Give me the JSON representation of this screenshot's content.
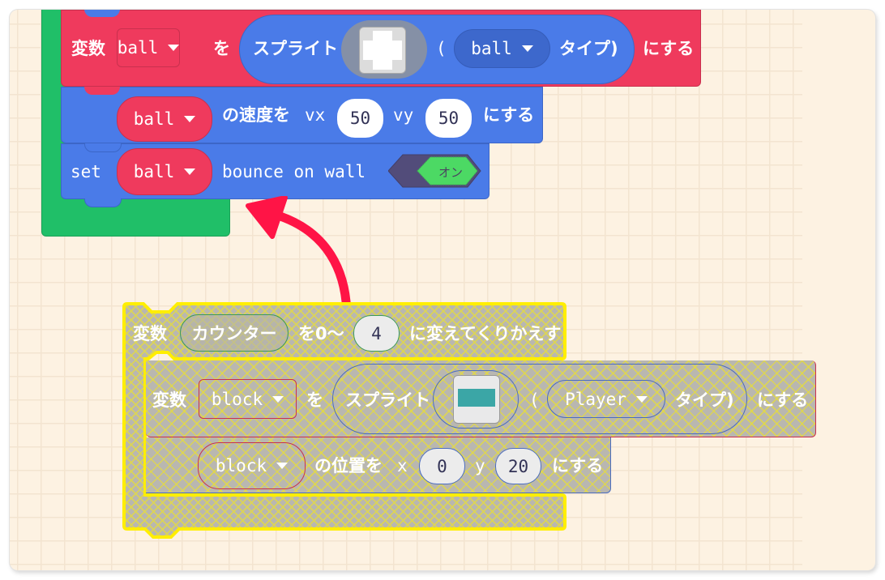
{
  "colors": {
    "workspace_bg": "#fdf2e2",
    "loop_green": "#20bf68",
    "variables_red": "#ef3a5d",
    "sprites_blue": "#4a7be8",
    "disabled_gray": "#b9b7b0",
    "highlight_yellow": "#ffee00",
    "arrow_red": "#ff1446",
    "toggle_on_green": "#4cd964",
    "toggle_track": "#524c7a"
  },
  "top_stack": {
    "set_var_block": {
      "prefix": "変数",
      "variable": "ball",
      "to_label": "を",
      "sprite_label": "スプライト",
      "sprite_image_icon": "white-plus-sprite-icon",
      "open_paren": "(",
      "kind": "ball",
      "kind_suffix": "タイプ)",
      "suffix": "にする"
    },
    "velocity_block": {
      "sprite": "ball",
      "label": "の速度を",
      "vx_label": "vx",
      "vx": "50",
      "vy_label": "vy",
      "vy": "50",
      "suffix": "にする"
    },
    "bounce_block": {
      "prefix": "set",
      "sprite": "ball",
      "label": "bounce on wall",
      "toggle_label": "オン",
      "toggle_state": "on"
    }
  },
  "arrow": {
    "icon": "curved-arrow-up-left-icon"
  },
  "dragged_stack": {
    "loop_block": {
      "prefix": "変数",
      "variable": "カウンター",
      "range_label": "を0〜",
      "end_value": "4",
      "suffix": "に変えてくりかえす"
    },
    "set_var_block": {
      "prefix": "変数",
      "variable": "block",
      "to_label": "を",
      "sprite_label": "スプライト",
      "sprite_image_icon": "teal-bar-sprite-icon",
      "open_paren": "(",
      "kind": "Player",
      "kind_suffix": "タイプ)",
      "suffix": "にする"
    },
    "position_block": {
      "sprite": "block",
      "label": "の位置を",
      "x_label": "x",
      "x": "0",
      "y_label": "y",
      "y": "20",
      "suffix": "にする"
    }
  }
}
